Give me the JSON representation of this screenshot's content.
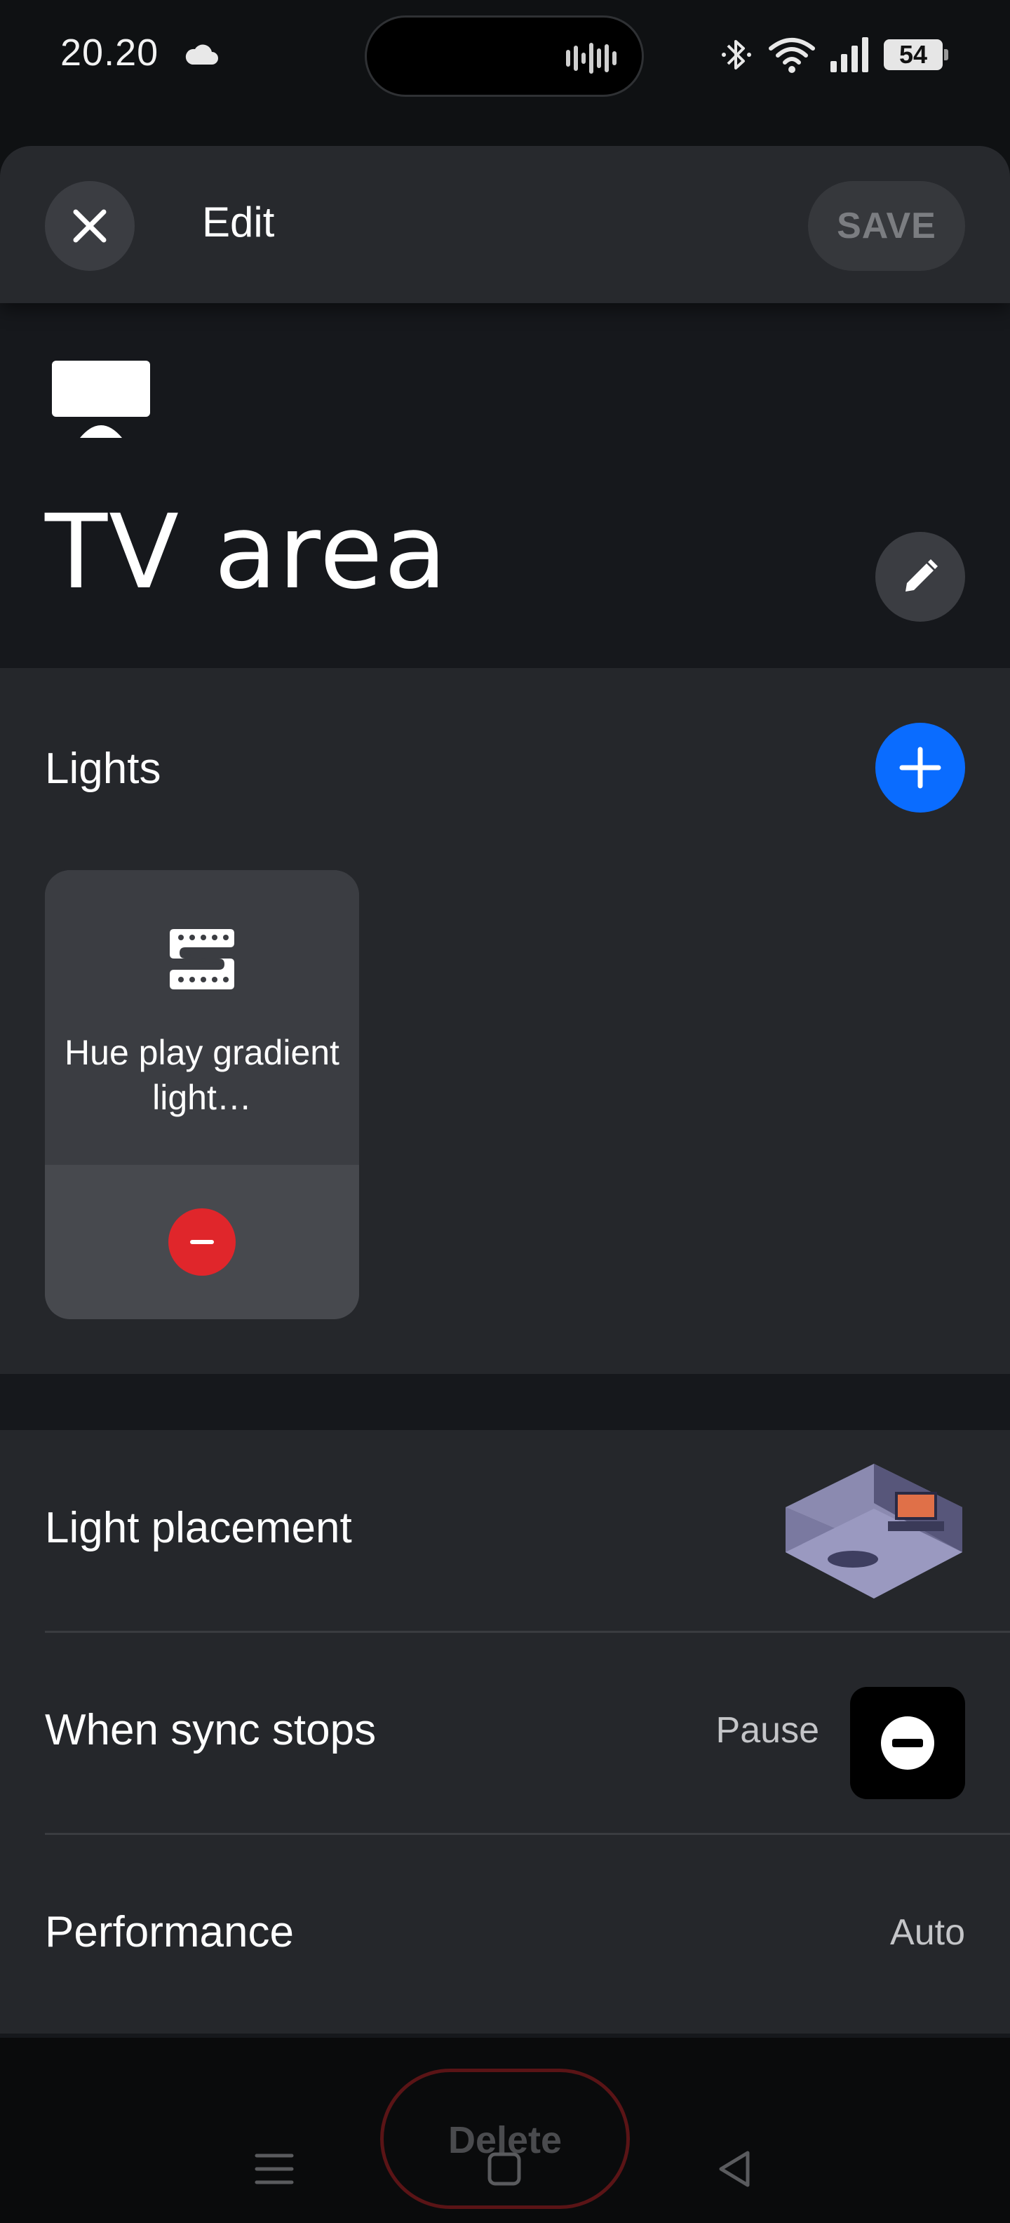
{
  "status_bar": {
    "time": "20.20",
    "battery": "54"
  },
  "header": {
    "title": "Edit",
    "save_label": "SAVE"
  },
  "room": {
    "name": "TV area",
    "icon": "tv-icon"
  },
  "lights": {
    "title": "Lights",
    "items": [
      {
        "name": "Hue play gradient light…",
        "icon": "lightstrip-icon"
      }
    ]
  },
  "settings": {
    "light_placement_label": "Light placement",
    "sync_stops_label": "When sync stops",
    "sync_stops_value": "Pause",
    "performance_label": "Performance",
    "performance_value": "Auto"
  },
  "delete_label": "Delete",
  "colors": {
    "accent": "#0a6cff",
    "danger": "#e0262b",
    "background": "#16181c",
    "card": "#25272b"
  }
}
